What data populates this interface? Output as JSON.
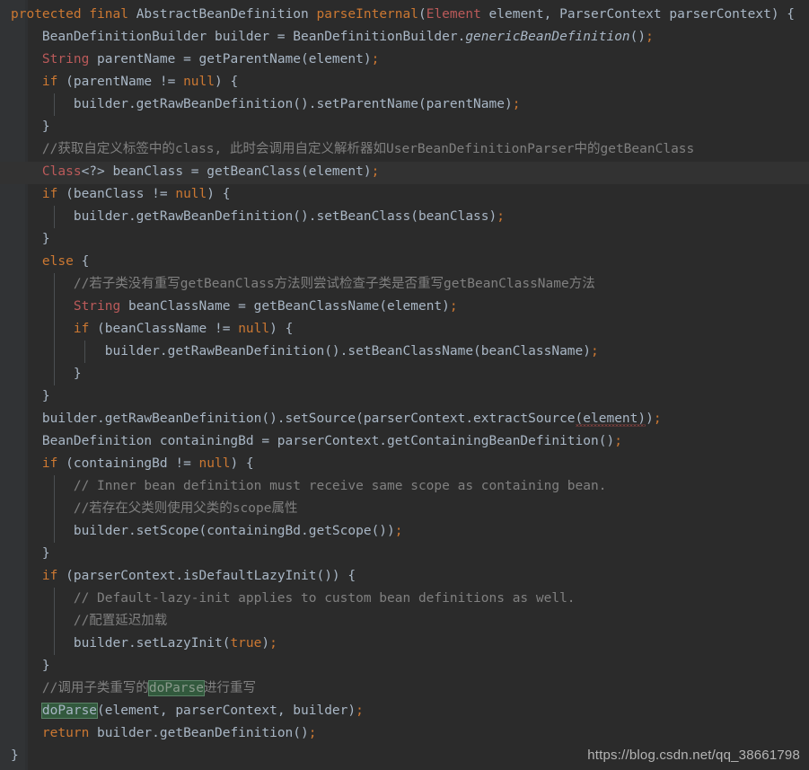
{
  "editor": {
    "background": "#2b2b2b",
    "gutter_color": "#313335",
    "caret_line_color": "#323232",
    "font_size_px": 14.5,
    "line_height_px": 25,
    "language": "java",
    "highlight_term": "doParse",
    "highlight_background": "#32593d",
    "highlight_border": "#5a8266"
  },
  "colors": {
    "keyword": "#cc7832",
    "type": "#bb5a5a",
    "identifier": "#a9b7c6",
    "comment": "#808080",
    "string": "#6a8759",
    "error_underline": "#c75450"
  },
  "watermark": {
    "text": "https://blog.csdn.net/qq_38661798"
  },
  "code": {
    "lines": [
      "protected final AbstractBeanDefinition parseInternal(Element element, ParserContext parserContext) {",
      "    BeanDefinitionBuilder builder = BeanDefinitionBuilder.genericBeanDefinition();",
      "    String parentName = getParentName(element);",
      "    if (parentName != null) {",
      "        builder.getRawBeanDefinition().setParentName(parentName);",
      "    }",
      "    //获取自定义标签中的class, 此时会调用自定义解析器如UserBeanDefinitionParser中的getBeanClass",
      "    Class<?> beanClass = getBeanClass(element);",
      "    if (beanClass != null) {",
      "        builder.getRawBeanDefinition().setBeanClass(beanClass);",
      "    }",
      "    else {",
      "        //若子类没有重写getBeanClass方法则尝试检查子类是否重写getBeanClassName方法",
      "        String beanClassName = getBeanClassName(element);",
      "        if (beanClassName != null) {",
      "            builder.getRawBeanDefinition().setBeanClassName(beanClassName);",
      "        }",
      "    }",
      "    builder.getRawBeanDefinition().setSource(parserContext.extractSource(element));",
      "    BeanDefinition containingBd = parserContext.getContainingBeanDefinition();",
      "    if (containingBd != null) {",
      "        // Inner bean definition must receive same scope as containing bean.",
      "        //若存在父类则使用父类的scope属性",
      "        builder.setScope(containingBd.getScope());",
      "    }",
      "    if (parserContext.isDefaultLazyInit()) {",
      "        // Default-lazy-init applies to custom bean definitions as well.",
      "        //配置延迟加载",
      "        builder.setLazyInit(true);",
      "    }",
      "    //调用子类重写的doParse进行重写",
      "    doParse(element, parserContext, builder);",
      "    return builder.getBeanDefinition();",
      "}"
    ],
    "tokens": [
      [
        {
          "t": "protected",
          "c": "kw"
        },
        {
          "t": " ",
          "c": "plain"
        },
        {
          "t": "final",
          "c": "kw"
        },
        {
          "t": " AbstractBeanDefinition ",
          "c": "plain"
        },
        {
          "t": "parseInternal",
          "c": "kw"
        },
        {
          "t": "(",
          "c": "plain"
        },
        {
          "t": "Element",
          "c": "type"
        },
        {
          "t": " element, ParserContext parserContext) {",
          "c": "plain"
        }
      ],
      [
        {
          "t": "    BeanDefinitionBuilder builder = BeanDefinitionBuilder.",
          "c": "plain"
        },
        {
          "t": "genericBeanDefinition",
          "c": "methodi"
        },
        {
          "t": "()",
          "c": "plain"
        },
        {
          "t": ";",
          "c": "semi"
        }
      ],
      [
        {
          "t": "    ",
          "c": "plain"
        },
        {
          "t": "String",
          "c": "type"
        },
        {
          "t": " parentName = getParentName(element)",
          "c": "plain"
        },
        {
          "t": ";",
          "c": "semi"
        }
      ],
      [
        {
          "t": "    ",
          "c": "plain"
        },
        {
          "t": "if",
          "c": "kw"
        },
        {
          "t": " (parentName != ",
          "c": "plain"
        },
        {
          "t": "null",
          "c": "kw"
        },
        {
          "t": ") {",
          "c": "plain"
        }
      ],
      [
        {
          "t": "        builder.getRawBeanDefinition().setParentName(parentName)",
          "c": "plain"
        },
        {
          "t": ";",
          "c": "semi"
        }
      ],
      [
        {
          "t": "    }",
          "c": "plain"
        }
      ],
      [
        {
          "t": "    //获取自定义标签中的class, 此时会调用自定义解析器如UserBeanDefinitionParser中的getBeanClass",
          "c": "comment"
        }
      ],
      [
        {
          "t": "    ",
          "c": "plain"
        },
        {
          "t": "Class",
          "c": "type"
        },
        {
          "t": "<?> beanClass = getBeanClass(element)",
          "c": "plain"
        },
        {
          "t": ";",
          "c": "semi"
        }
      ],
      [
        {
          "t": "    ",
          "c": "plain"
        },
        {
          "t": "if",
          "c": "kw"
        },
        {
          "t": " (beanClass != ",
          "c": "plain"
        },
        {
          "t": "null",
          "c": "kw"
        },
        {
          "t": ") {",
          "c": "plain"
        }
      ],
      [
        {
          "t": "        builder.getRawBeanDefinition().setBeanClass(beanClass)",
          "c": "plain"
        },
        {
          "t": ";",
          "c": "semi"
        }
      ],
      [
        {
          "t": "    }",
          "c": "plain"
        }
      ],
      [
        {
          "t": "    ",
          "c": "plain"
        },
        {
          "t": "else",
          "c": "kw"
        },
        {
          "t": " {",
          "c": "plain"
        }
      ],
      [
        {
          "t": "        //若子类没有重写getBeanClass方法则尝试检查子类是否重写getBeanClassName方法",
          "c": "comment"
        }
      ],
      [
        {
          "t": "        ",
          "c": "plain"
        },
        {
          "t": "String",
          "c": "type"
        },
        {
          "t": " beanClassName = getBeanClassName(element)",
          "c": "plain"
        },
        {
          "t": ";",
          "c": "semi"
        }
      ],
      [
        {
          "t": "        ",
          "c": "plain"
        },
        {
          "t": "if",
          "c": "kw"
        },
        {
          "t": " (beanClassName != ",
          "c": "plain"
        },
        {
          "t": "null",
          "c": "kw"
        },
        {
          "t": ") {",
          "c": "plain"
        }
      ],
      [
        {
          "t": "            builder.getRawBeanDefinition().setBeanClassName(beanClassName)",
          "c": "plain"
        },
        {
          "t": ";",
          "c": "semi"
        }
      ],
      [
        {
          "t": "        }",
          "c": "plain"
        }
      ],
      [
        {
          "t": "    }",
          "c": "plain"
        }
      ],
      [
        {
          "t": "    builder.getRawBeanDefinition().setSource(parserContext.extractSource",
          "c": "plain"
        },
        {
          "t": "(element)",
          "c": "plain squiggle"
        },
        {
          "t": ")",
          "c": "plain"
        },
        {
          "t": ";",
          "c": "semi"
        }
      ],
      [
        {
          "t": "    BeanDefinition containingBd = parserContext.getContainingBeanDefinition()",
          "c": "plain"
        },
        {
          "t": ";",
          "c": "semi"
        }
      ],
      [
        {
          "t": "    ",
          "c": "plain"
        },
        {
          "t": "if",
          "c": "kw"
        },
        {
          "t": " (containingBd != ",
          "c": "plain"
        },
        {
          "t": "null",
          "c": "kw"
        },
        {
          "t": ") {",
          "c": "plain"
        }
      ],
      [
        {
          "t": "        // Inner bean definition must receive same scope as containing bean.",
          "c": "comment"
        }
      ],
      [
        {
          "t": "        //若存在父类则使用父类的scope属性",
          "c": "comment"
        }
      ],
      [
        {
          "t": "        builder.setScope(containingBd.getScope())",
          "c": "plain"
        },
        {
          "t": ";",
          "c": "semi"
        }
      ],
      [
        {
          "t": "    }",
          "c": "plain"
        }
      ],
      [
        {
          "t": "    ",
          "c": "plain"
        },
        {
          "t": "if",
          "c": "kw"
        },
        {
          "t": " (parserContext.isDefaultLazyInit()) {",
          "c": "plain"
        }
      ],
      [
        {
          "t": "        // Default-lazy-init applies to custom bean definitions as well.",
          "c": "comment"
        }
      ],
      [
        {
          "t": "        //配置延迟加载",
          "c": "comment"
        }
      ],
      [
        {
          "t": "        builder.setLazyInit(",
          "c": "plain"
        },
        {
          "t": "true",
          "c": "kw"
        },
        {
          "t": ")",
          "c": "plain"
        },
        {
          "t": ";",
          "c": "semi"
        }
      ],
      [
        {
          "t": "    }",
          "c": "plain"
        }
      ],
      [
        {
          "t": "    //调用子类重写的",
          "c": "comment"
        },
        {
          "t": "doParse",
          "c": "hl-comment"
        },
        {
          "t": "进行重写",
          "c": "comment"
        }
      ],
      [
        {
          "t": "    ",
          "c": "plain"
        },
        {
          "t": "doParse",
          "c": "hl"
        },
        {
          "t": "(element, parserContext, builder)",
          "c": "plain"
        },
        {
          "t": ";",
          "c": "semi"
        }
      ],
      [
        {
          "t": "    ",
          "c": "plain"
        },
        {
          "t": "return",
          "c": "kw"
        },
        {
          "t": " builder.getBeanDefinition()",
          "c": "plain"
        },
        {
          "t": ";",
          "c": "semi"
        }
      ],
      [
        {
          "t": "}",
          "c": "plain"
        }
      ]
    ],
    "guides": [
      [],
      [],
      [],
      [],
      [
        60
      ],
      [],
      [],
      [],
      [],
      [
        60
      ],
      [],
      [],
      [
        60
      ],
      [
        60
      ],
      [
        60
      ],
      [
        60,
        94
      ],
      [
        60
      ],
      [],
      [],
      [],
      [],
      [
        60
      ],
      [
        60
      ],
      [
        60
      ],
      [],
      [],
      [
        60
      ],
      [
        60
      ],
      [
        60
      ],
      [],
      [],
      [],
      [],
      []
    ]
  }
}
